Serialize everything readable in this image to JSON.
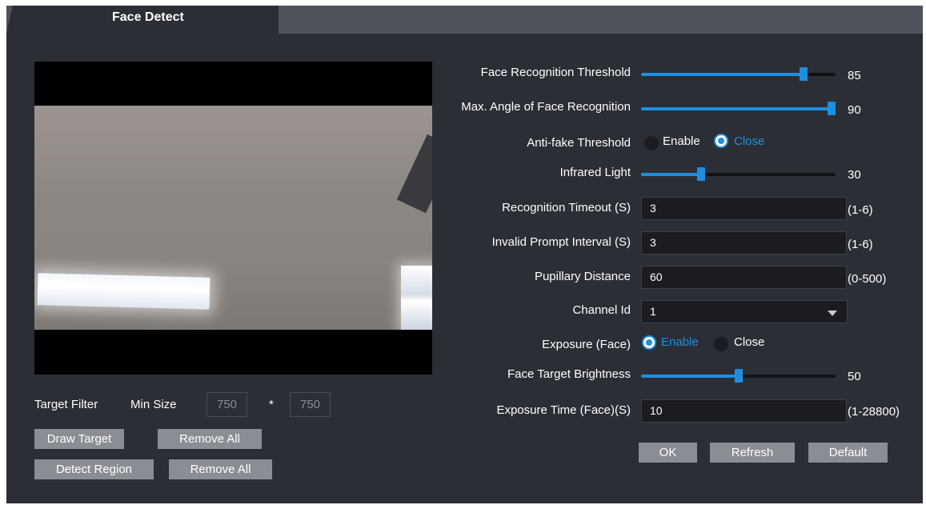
{
  "tab": {
    "label": "Face Detect"
  },
  "target_filter": {
    "label": "Target Filter",
    "min_size_label": "Min Size",
    "width": "750",
    "separator": "*",
    "height": "750"
  },
  "buttons": {
    "draw_target": "Draw Target",
    "remove_all_1": "Remove All",
    "detect_region": "Detect Region",
    "remove_all_2": "Remove All",
    "ok": "OK",
    "refresh": "Refresh",
    "default": "Default"
  },
  "settings": {
    "face_recognition_threshold": {
      "label": "Face Recognition Threshold",
      "value": "85",
      "level": 0.85
    },
    "max_angle": {
      "label": "Max. Angle of Face Recognition",
      "value": "90",
      "level": 1.0
    },
    "anti_fake": {
      "label": "Anti-fake Threshold",
      "enable": "Enable",
      "close": "Close",
      "selected": "Close"
    },
    "infrared_light": {
      "label": "Infrared Light",
      "value": "30",
      "level": 0.3
    },
    "recognition_timeout": {
      "label": "Recognition Timeout (S)",
      "value": "3",
      "range": "(1-6)"
    },
    "invalid_prompt_interval": {
      "label": "Invalid Prompt Interval (S)",
      "value": "3",
      "range": "(1-6)"
    },
    "pupillary_distance": {
      "label": "Pupillary Distance",
      "value": "60",
      "range": "(0-500)"
    },
    "channel_id": {
      "label": "Channel Id",
      "value": "1"
    },
    "exposure_face": {
      "label": "Exposure (Face)",
      "enable": "Enable",
      "close": "Close",
      "selected": "Enable"
    },
    "face_target_brightness": {
      "label": "Face Target Brightness",
      "value": "50",
      "level": 0.5
    },
    "exposure_time": {
      "label": "Exposure Time (Face)(S)",
      "value": "10",
      "range": "(1-28800)"
    }
  },
  "colors": {
    "accent": "#1e8fe0",
    "panel": "#2b2e35",
    "button": "#8a8d93"
  },
  "icons": {
    "select_arrow": "chevron-down-icon"
  }
}
